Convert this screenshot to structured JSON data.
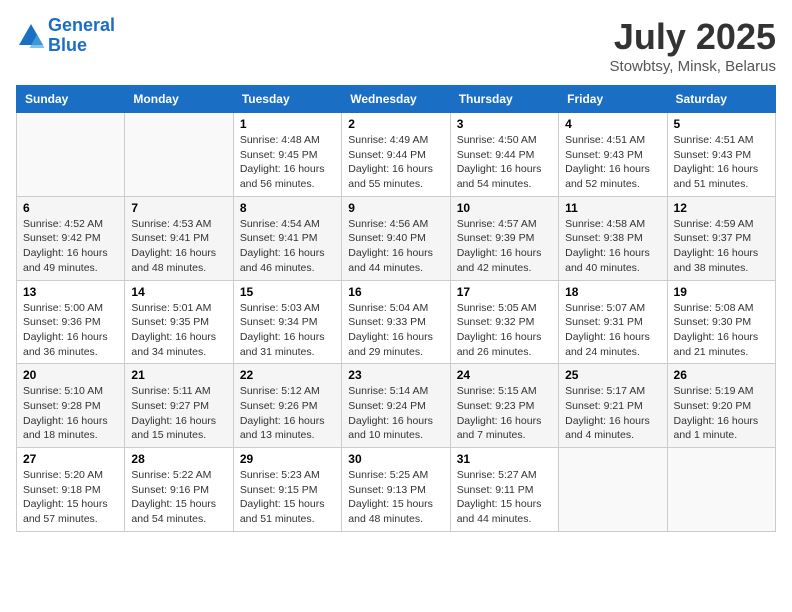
{
  "header": {
    "logo_line1": "General",
    "logo_line2": "Blue",
    "month": "July 2025",
    "location": "Stowbtsy, Minsk, Belarus"
  },
  "days_of_week": [
    "Sunday",
    "Monday",
    "Tuesday",
    "Wednesday",
    "Thursday",
    "Friday",
    "Saturday"
  ],
  "weeks": [
    [
      {
        "day": "",
        "info": ""
      },
      {
        "day": "",
        "info": ""
      },
      {
        "day": "1",
        "info": "Sunrise: 4:48 AM\nSunset: 9:45 PM\nDaylight: 16 hours and 56 minutes."
      },
      {
        "day": "2",
        "info": "Sunrise: 4:49 AM\nSunset: 9:44 PM\nDaylight: 16 hours and 55 minutes."
      },
      {
        "day": "3",
        "info": "Sunrise: 4:50 AM\nSunset: 9:44 PM\nDaylight: 16 hours and 54 minutes."
      },
      {
        "day": "4",
        "info": "Sunrise: 4:51 AM\nSunset: 9:43 PM\nDaylight: 16 hours and 52 minutes."
      },
      {
        "day": "5",
        "info": "Sunrise: 4:51 AM\nSunset: 9:43 PM\nDaylight: 16 hours and 51 minutes."
      }
    ],
    [
      {
        "day": "6",
        "info": "Sunrise: 4:52 AM\nSunset: 9:42 PM\nDaylight: 16 hours and 49 minutes."
      },
      {
        "day": "7",
        "info": "Sunrise: 4:53 AM\nSunset: 9:41 PM\nDaylight: 16 hours and 48 minutes."
      },
      {
        "day": "8",
        "info": "Sunrise: 4:54 AM\nSunset: 9:41 PM\nDaylight: 16 hours and 46 minutes."
      },
      {
        "day": "9",
        "info": "Sunrise: 4:56 AM\nSunset: 9:40 PM\nDaylight: 16 hours and 44 minutes."
      },
      {
        "day": "10",
        "info": "Sunrise: 4:57 AM\nSunset: 9:39 PM\nDaylight: 16 hours and 42 minutes."
      },
      {
        "day": "11",
        "info": "Sunrise: 4:58 AM\nSunset: 9:38 PM\nDaylight: 16 hours and 40 minutes."
      },
      {
        "day": "12",
        "info": "Sunrise: 4:59 AM\nSunset: 9:37 PM\nDaylight: 16 hours and 38 minutes."
      }
    ],
    [
      {
        "day": "13",
        "info": "Sunrise: 5:00 AM\nSunset: 9:36 PM\nDaylight: 16 hours and 36 minutes."
      },
      {
        "day": "14",
        "info": "Sunrise: 5:01 AM\nSunset: 9:35 PM\nDaylight: 16 hours and 34 minutes."
      },
      {
        "day": "15",
        "info": "Sunrise: 5:03 AM\nSunset: 9:34 PM\nDaylight: 16 hours and 31 minutes."
      },
      {
        "day": "16",
        "info": "Sunrise: 5:04 AM\nSunset: 9:33 PM\nDaylight: 16 hours and 29 minutes."
      },
      {
        "day": "17",
        "info": "Sunrise: 5:05 AM\nSunset: 9:32 PM\nDaylight: 16 hours and 26 minutes."
      },
      {
        "day": "18",
        "info": "Sunrise: 5:07 AM\nSunset: 9:31 PM\nDaylight: 16 hours and 24 minutes."
      },
      {
        "day": "19",
        "info": "Sunrise: 5:08 AM\nSunset: 9:30 PM\nDaylight: 16 hours and 21 minutes."
      }
    ],
    [
      {
        "day": "20",
        "info": "Sunrise: 5:10 AM\nSunset: 9:28 PM\nDaylight: 16 hours and 18 minutes."
      },
      {
        "day": "21",
        "info": "Sunrise: 5:11 AM\nSunset: 9:27 PM\nDaylight: 16 hours and 15 minutes."
      },
      {
        "day": "22",
        "info": "Sunrise: 5:12 AM\nSunset: 9:26 PM\nDaylight: 16 hours and 13 minutes."
      },
      {
        "day": "23",
        "info": "Sunrise: 5:14 AM\nSunset: 9:24 PM\nDaylight: 16 hours and 10 minutes."
      },
      {
        "day": "24",
        "info": "Sunrise: 5:15 AM\nSunset: 9:23 PM\nDaylight: 16 hours and 7 minutes."
      },
      {
        "day": "25",
        "info": "Sunrise: 5:17 AM\nSunset: 9:21 PM\nDaylight: 16 hours and 4 minutes."
      },
      {
        "day": "26",
        "info": "Sunrise: 5:19 AM\nSunset: 9:20 PM\nDaylight: 16 hours and 1 minute."
      }
    ],
    [
      {
        "day": "27",
        "info": "Sunrise: 5:20 AM\nSunset: 9:18 PM\nDaylight: 15 hours and 57 minutes."
      },
      {
        "day": "28",
        "info": "Sunrise: 5:22 AM\nSunset: 9:16 PM\nDaylight: 15 hours and 54 minutes."
      },
      {
        "day": "29",
        "info": "Sunrise: 5:23 AM\nSunset: 9:15 PM\nDaylight: 15 hours and 51 minutes."
      },
      {
        "day": "30",
        "info": "Sunrise: 5:25 AM\nSunset: 9:13 PM\nDaylight: 15 hours and 48 minutes."
      },
      {
        "day": "31",
        "info": "Sunrise: 5:27 AM\nSunset: 9:11 PM\nDaylight: 15 hours and 44 minutes."
      },
      {
        "day": "",
        "info": ""
      },
      {
        "day": "",
        "info": ""
      }
    ]
  ]
}
